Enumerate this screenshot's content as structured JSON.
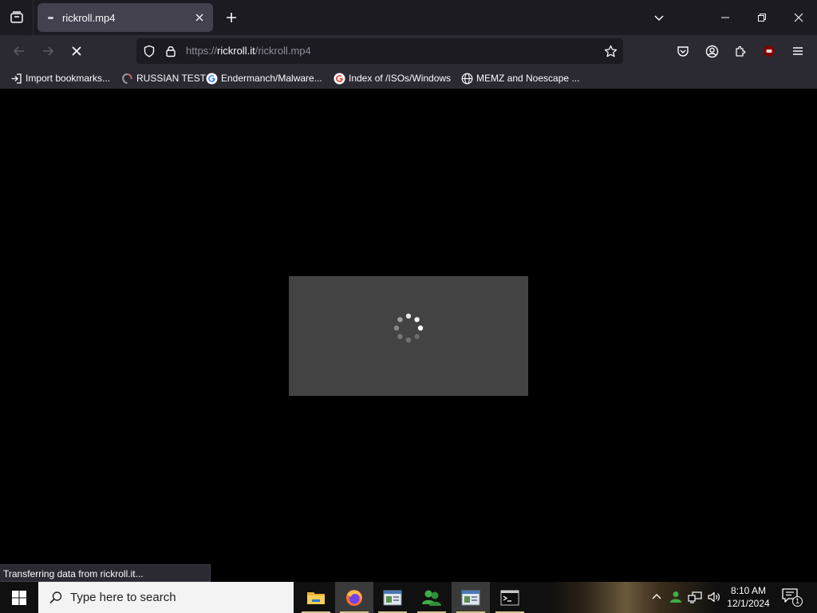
{
  "tab": {
    "title": "rickroll.mp4"
  },
  "navbar": {
    "url_scheme": "https://",
    "url_host": "rickroll.it",
    "url_path": "/rickroll.mp4"
  },
  "bookmarks": [
    {
      "label": "Import bookmarks...",
      "icon": "import-icon"
    },
    {
      "label": "RUSSIAN TEST",
      "icon": "site-favicon"
    },
    {
      "label": "Endermanch/Malware...",
      "icon": "google-icon"
    },
    {
      "label": "Index of /ISOs/Windows",
      "icon": "google-icon"
    },
    {
      "label": "MEMZ and Noescape ...",
      "icon": "globe-icon"
    }
  ],
  "status": {
    "text": "Transferring data from rickroll.it..."
  },
  "taskbar": {
    "search_placeholder": "Type here to search",
    "time": "8:10 AM",
    "date": "12/1/2024",
    "notification_count": "1"
  },
  "colors": {
    "accent": "#d6c48a",
    "toolbar": "#2b2a33",
    "tabstrip": "#1c1b22",
    "ublock": "#800000"
  }
}
